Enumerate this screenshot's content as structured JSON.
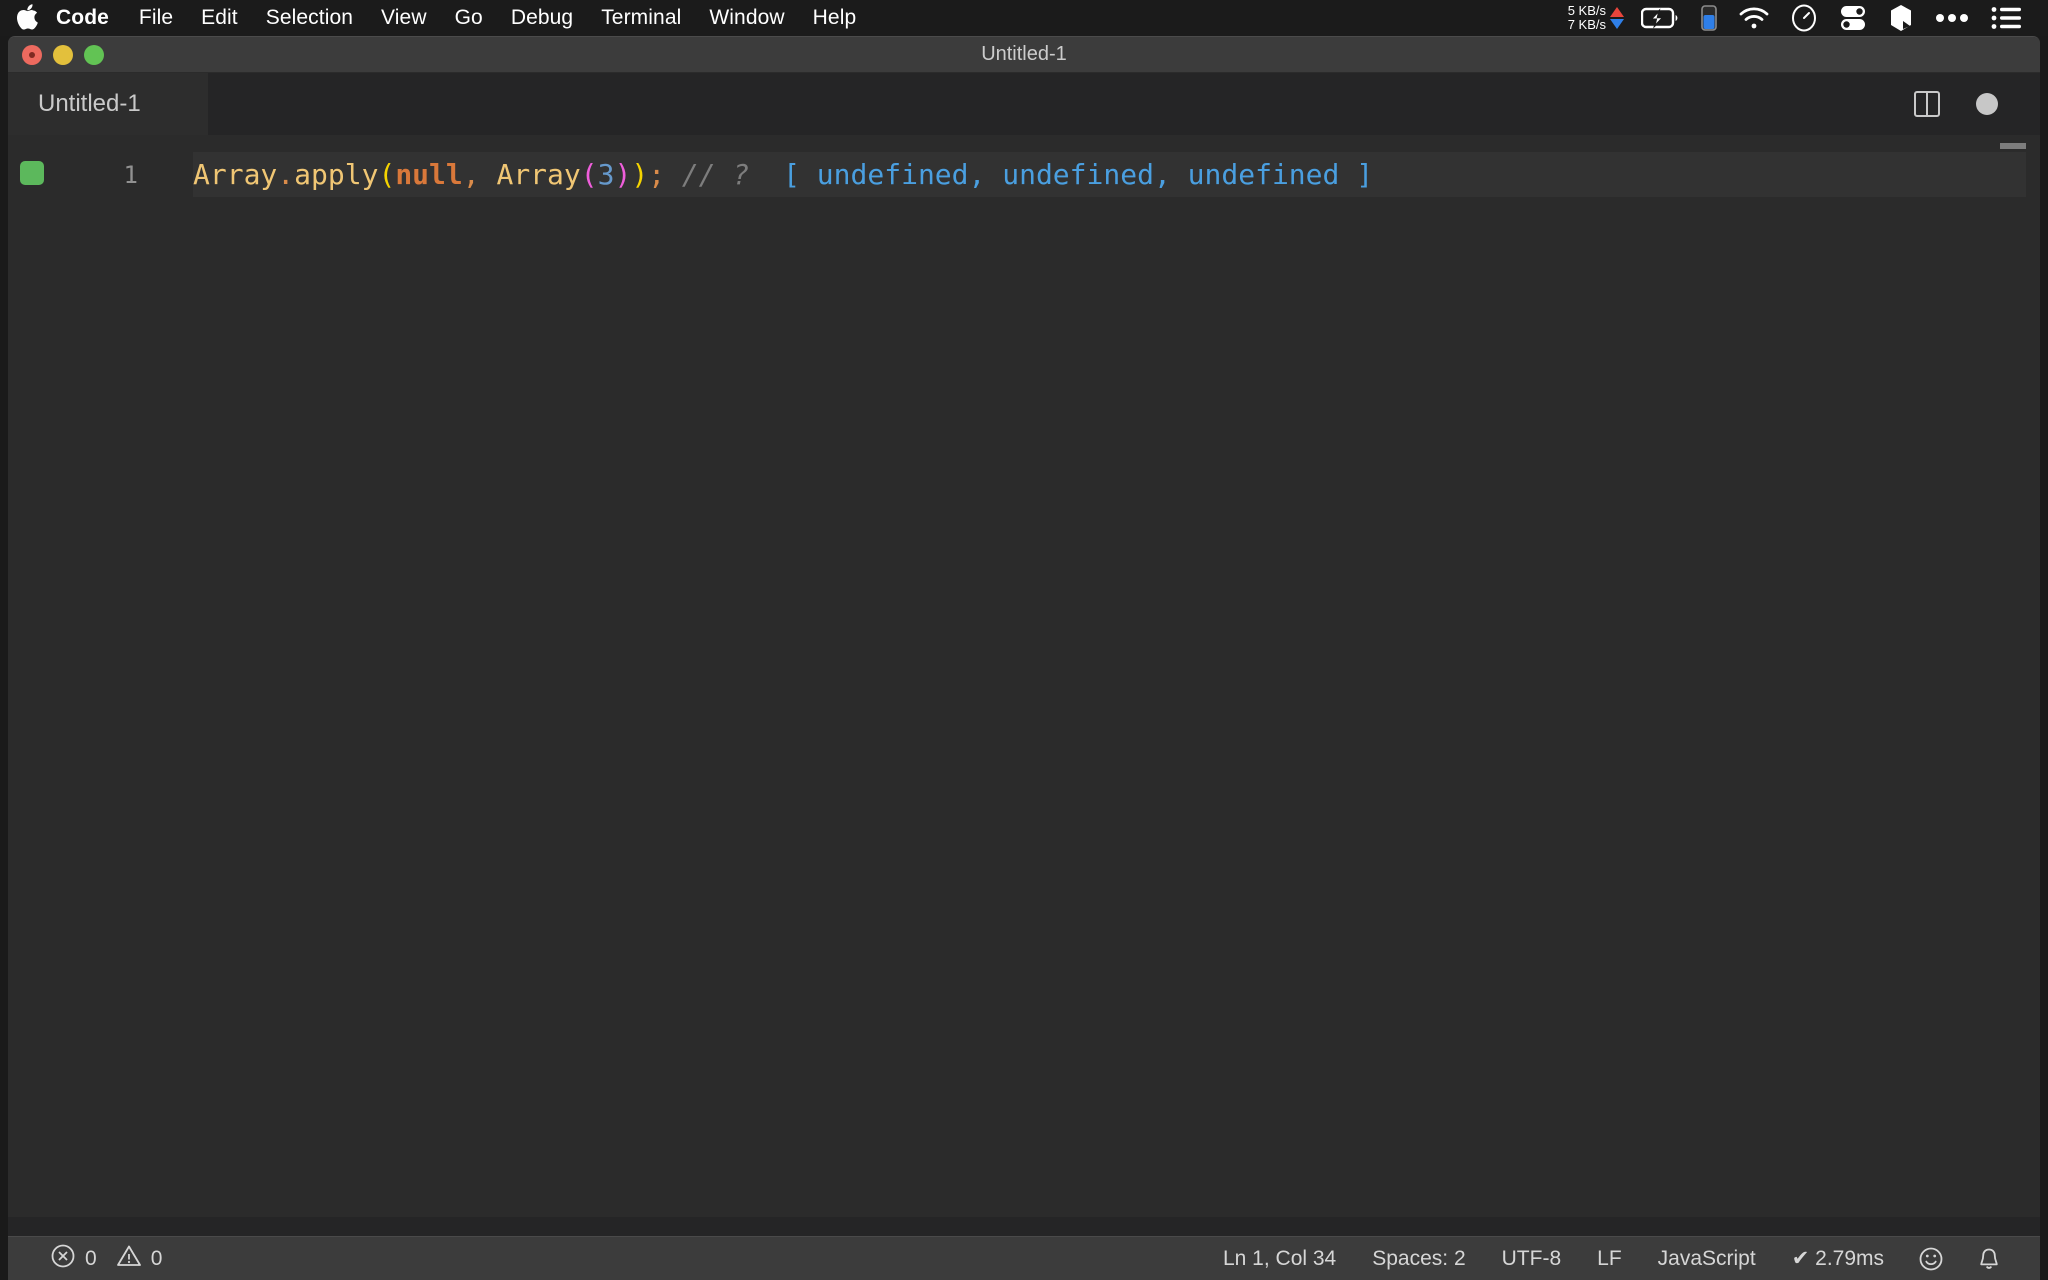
{
  "menubar": {
    "apple_icon": "apple-logo-icon",
    "items": [
      {
        "label": "Code",
        "bold": true
      },
      {
        "label": "File",
        "bold": false
      },
      {
        "label": "Edit",
        "bold": false
      },
      {
        "label": "Selection",
        "bold": false
      },
      {
        "label": "View",
        "bold": false
      },
      {
        "label": "Go",
        "bold": false
      },
      {
        "label": "Debug",
        "bold": false
      },
      {
        "label": "Terminal",
        "bold": false
      },
      {
        "label": "Window",
        "bold": false
      },
      {
        "label": "Help",
        "bold": false
      }
    ],
    "tray": {
      "upload_speed": "5 KB/s",
      "download_speed": "7 KB/s",
      "upload_color": "#e8453c",
      "download_color": "#2f7fe8",
      "icons": [
        "battery-charging-icon",
        "blue-bar-indicator-icon",
        "wifi-icon",
        "clock-gauge-icon",
        "toggles-icon",
        "cube-icon",
        "ellipsis-icon",
        "control-center-list-icon"
      ]
    }
  },
  "window": {
    "title": "Untitled-1",
    "traffic_lights": [
      "close",
      "minimize",
      "zoom"
    ]
  },
  "tabs": [
    {
      "label": "Untitled-1",
      "active": true
    }
  ],
  "editor_actions": {
    "split_editor": "split-editor-icon",
    "unsaved_dot": "unsaved-dot-icon"
  },
  "editor": {
    "line_number": "1",
    "quokka_marker_color": "#5cb85c",
    "code_tokens": [
      {
        "text": "Array",
        "type": "func"
      },
      {
        "text": ".",
        "type": "punc"
      },
      {
        "text": "apply",
        "type": "func"
      },
      {
        "text": "(",
        "type": "paren1"
      },
      {
        "text": "null",
        "type": "kw"
      },
      {
        "text": ",",
        "type": "punc"
      },
      {
        "text": " ",
        "type": "plain"
      },
      {
        "text": "Array",
        "type": "func"
      },
      {
        "text": "(",
        "type": "paren2"
      },
      {
        "text": "3",
        "type": "num"
      },
      {
        "text": ")",
        "type": "paren2"
      },
      {
        "text": ")",
        "type": "paren1"
      },
      {
        "text": ";",
        "type": "punc"
      },
      {
        "text": " ",
        "type": "plain"
      },
      {
        "text": "// ?",
        "type": "comment"
      },
      {
        "text": "  ",
        "type": "plain"
      },
      {
        "text": "[ undefined, undefined, undefined ]",
        "type": "result"
      }
    ],
    "full_line_text": "Array.apply(null, Array(3)); // ?  [ undefined, undefined, undefined ]"
  },
  "statusbar": {
    "errors_icon": "error-circle-icon",
    "errors_count": "0",
    "warnings_icon": "warning-triangle-icon",
    "warnings_count": "0",
    "cursor_position": "Ln 1, Col 34",
    "indentation": "Spaces: 2",
    "encoding": "UTF-8",
    "eol": "LF",
    "language": "JavaScript",
    "quokka_status": "✔ 2.79ms",
    "smiley_icon": "smiley-feedback-icon",
    "bell_icon": "notifications-bell-icon"
  },
  "colors": {
    "menubar_bg": "#1b1b1b",
    "titlebar_bg": "#3c3c3c",
    "tab_active_bg": "#2d2d2d",
    "editor_bg": "#2b2b2b",
    "line_highlight_bg": "#323232",
    "statusbar_bg": "#3c3c3c"
  }
}
